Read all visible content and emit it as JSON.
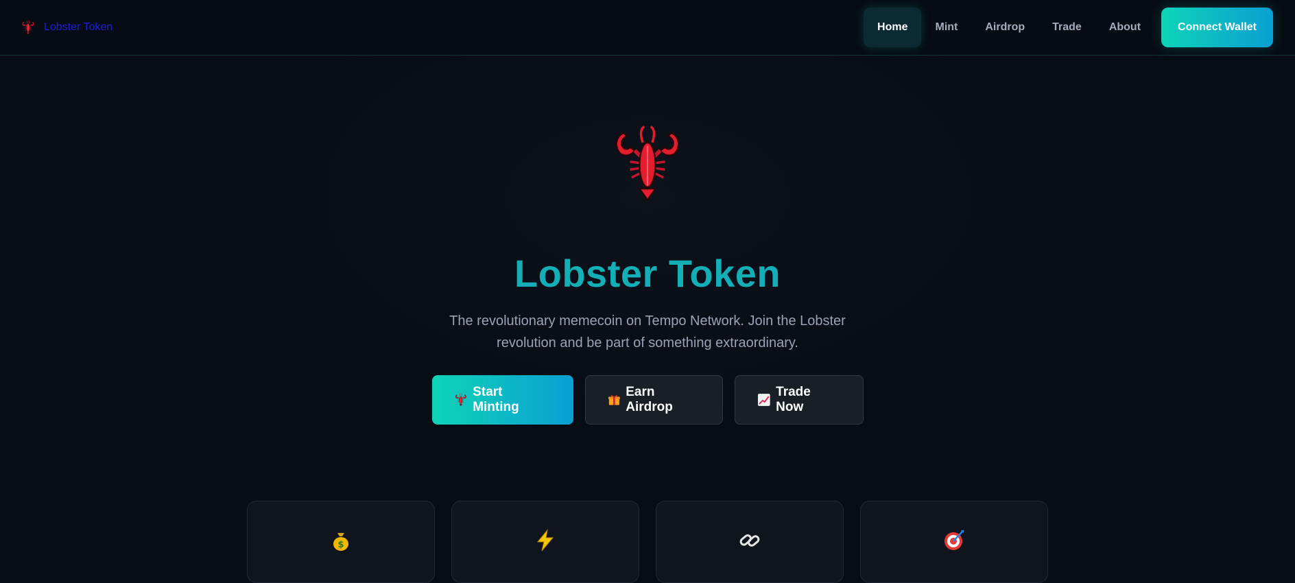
{
  "nav": {
    "brand_icon": "lobster-icon",
    "brand_text": "Lobster Token",
    "links": [
      {
        "label": "Home",
        "active": true
      },
      {
        "label": "Mint",
        "active": false
      },
      {
        "label": "Airdrop",
        "active": false
      },
      {
        "label": "Trade",
        "active": false
      },
      {
        "label": "About",
        "active": false
      }
    ],
    "connect_label": "Connect Wallet"
  },
  "hero": {
    "icon": "lobster-icon",
    "title": "Lobster Token",
    "subtitle": "The revolutionary memecoin on Tempo Network. Join the Lobster revolution and be part of something extraordinary.",
    "buttons": [
      {
        "icon": "lobster-icon",
        "label": "Start Minting"
      },
      {
        "icon": "gift-icon",
        "label": "Earn Airdrop"
      },
      {
        "icon": "chart-increasing-icon",
        "label": "Trade Now"
      }
    ]
  },
  "features": [
    {
      "icon": "money-bag-icon"
    },
    {
      "icon": "lightning-icon"
    },
    {
      "icon": "link-icon"
    },
    {
      "icon": "target-icon"
    }
  ],
  "colors": {
    "accent_start": "#0fd3b7",
    "accent_end": "#0b9fd3",
    "title": "#13aeb6",
    "background": "#080c14"
  }
}
